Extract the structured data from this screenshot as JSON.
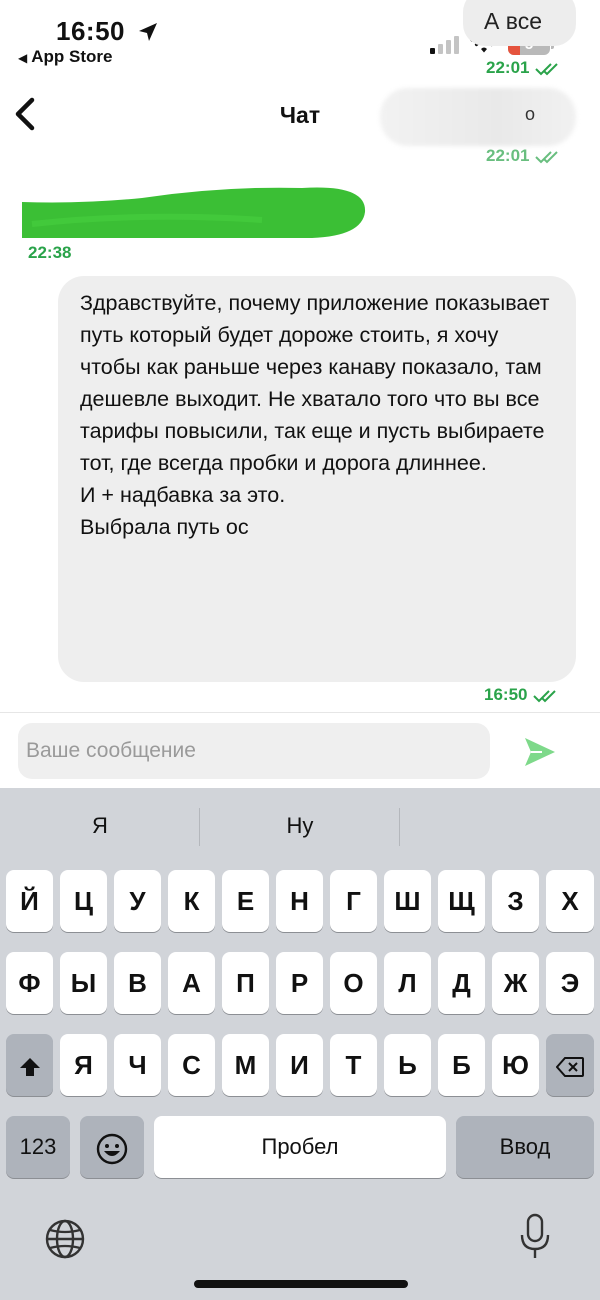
{
  "status": {
    "time": "16:50",
    "back_app": "App Store",
    "battery": "5"
  },
  "colors": {
    "accent_green": "#2aa34a",
    "bubble_gray": "#eeeeee",
    "keyboard_bg": "#d1d4d9"
  },
  "chat_header": {
    "title": "Чат",
    "contact_partial": "о"
  },
  "messages": [
    {
      "text": "А все",
      "time": "22:01"
    },
    {
      "time": "22:01"
    },
    {
      "time": "22:38"
    },
    {
      "text": "Здравствуйте, почему приложение показывает путь который будет дороже стоить, я хочу чтобы как раньше через канаву показало, там дешевле выходит. Не хватало того что вы все тарифы повысили, так еще и пусть выбираете тот, где всегда пробки и дорога длиннее.\nИ + надбавка за это.\nВыбрала путь ос",
      "time": "16:50"
    }
  ],
  "composer": {
    "placeholder": "Ваше сообщение",
    "send_icon": "send-arrow-icon"
  },
  "keyboard": {
    "suggestions": [
      "Я",
      "Ну",
      ""
    ],
    "row1": [
      "Й",
      "Ц",
      "У",
      "К",
      "Е",
      "Н",
      "Г",
      "Ш",
      "Щ",
      "З",
      "Х"
    ],
    "row2": [
      "Ф",
      "Ы",
      "В",
      "А",
      "П",
      "Р",
      "О",
      "Л",
      "Д",
      "Ж",
      "Э"
    ],
    "row3": [
      "Я",
      "Ч",
      "С",
      "М",
      "И",
      "Т",
      "Ь",
      "Б",
      "Ю"
    ],
    "numbers_label": "123",
    "space_label": "Пробел",
    "return_label": "Ввод"
  }
}
